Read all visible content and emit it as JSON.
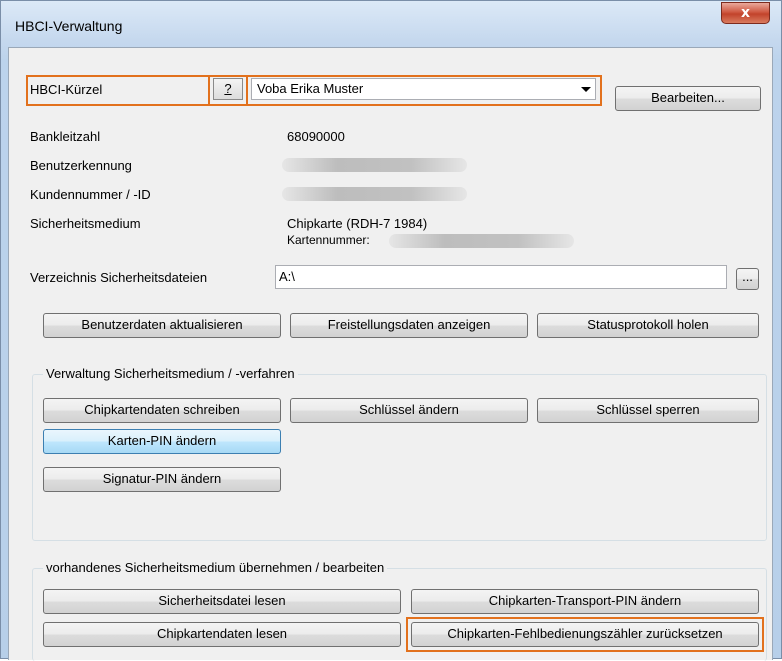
{
  "window": {
    "title": "HBCI-Verwaltung",
    "close_glyph": "x"
  },
  "kuerzel": {
    "label": "HBCI-Kürzel",
    "help_label": "?",
    "selected": "Voba Erika Muster",
    "edit_button": "Bearbeiten..."
  },
  "info": {
    "blz_label": "Bankleitzahl",
    "blz_value": "68090000",
    "benutzer_label": "Benutzerkennung",
    "kunden_label": "Kundennummer / -ID",
    "medium_label": "Sicherheitsmedium",
    "medium_value": "Chipkarte  (RDH-7  1984)",
    "kartennummer_label": "Kartennummer:"
  },
  "verzeichnis": {
    "label": "Verzeichnis Sicherheitsdateien",
    "value": "A:\\",
    "browse": "..."
  },
  "actions": {
    "benutzerdaten": "Benutzerdaten aktualisieren",
    "freistellung": "Freistellungsdaten anzeigen",
    "status": "Statusprotokoll holen"
  },
  "group1": {
    "title": "Verwaltung Sicherheitsmedium / -verfahren",
    "chip_schreiben": "Chipkartendaten schreiben",
    "schluessel_aendern": "Schlüssel ändern",
    "schluessel_sperren": "Schlüssel sperren",
    "karten_pin": "Karten-PIN ändern",
    "signatur_pin": "Signatur-PIN ändern"
  },
  "group2": {
    "title": "vorhandenes Sicherheitsmedium übernehmen / bearbeiten",
    "datei_lesen": "Sicherheitsdatei lesen",
    "transport_pin": "Chipkarten-Transport-PIN ändern",
    "chip_lesen": "Chipkartendaten lesen",
    "fehlbedienung": "Chipkarten-Fehlbedienungszähler zurücksetzen"
  },
  "colors": {
    "highlight": "#e2711d",
    "focus_button": "#bee6fd",
    "close_button": "#c2432b"
  }
}
